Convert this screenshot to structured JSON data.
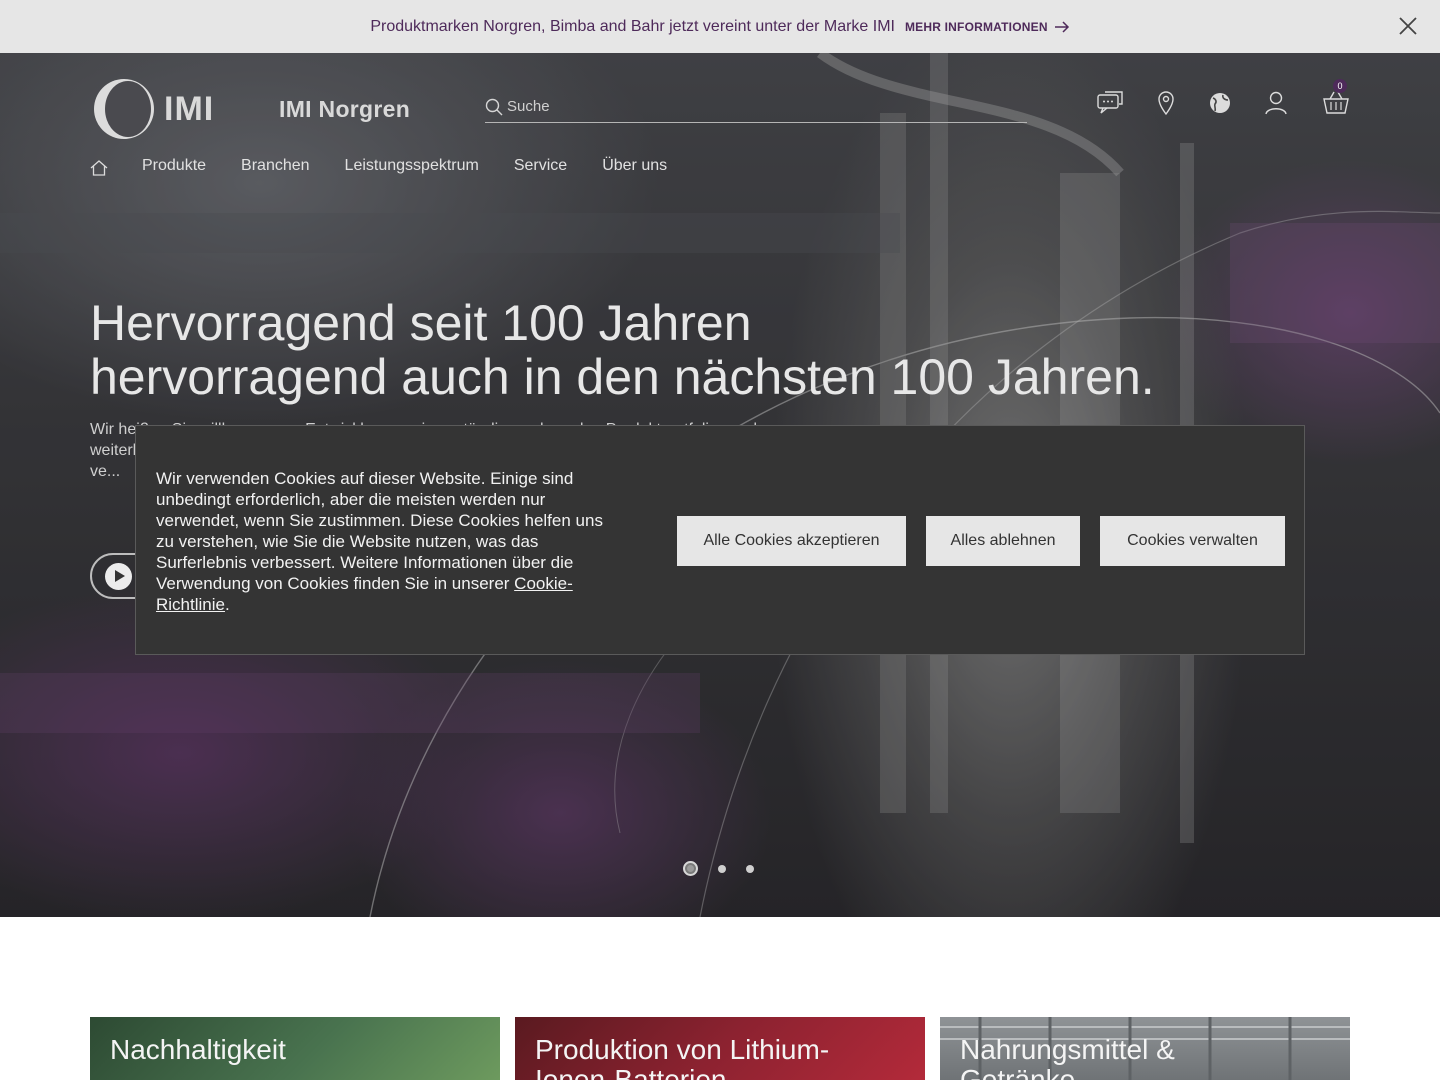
{
  "announcement": {
    "text": "Produktmarken Norgren, Bimba and Bahr jetzt vereint unter der Marke IMI",
    "link_label": "MEHR INFORMATIONEN"
  },
  "header": {
    "logo_text": "IMI",
    "brand_name": "IMI Norgren",
    "search_placeholder": "Suche",
    "cart_count": "0",
    "icons": [
      "chat-icon",
      "location-icon",
      "globe-icon",
      "user-icon",
      "cart-icon"
    ]
  },
  "nav": {
    "items": [
      "Produkte",
      "Branchen",
      "Leistungsspektrum",
      "Service",
      "Über uns"
    ]
  },
  "hero": {
    "title_line1": "Hervorragend seit 100 Jahren",
    "title_line2": "hervorragend auch in den nächsten 100 Jahren.",
    "subtitle": "Wir heißen Sie willkommen ... Entwicklungen eines ständig wachsenden Produktportfolios und weiterhin in guter Zusammenarbeit. Nutzen Sie das Know-how u... technik, um Sie... und Ihr - ve..."
  },
  "carousel": {
    "slides": 3,
    "active_index": 0
  },
  "cookie_banner": {
    "text": "Wir verwenden Cookies auf dieser Website. Einige sind unbedingt erforderlich, aber die meisten werden nur verwendet, wenn Sie zustimmen. Diese Cookies helfen uns zu verstehen, wie Sie die Website nutzen, was das Surferlebnis verbessert. Weitere Informationen über die Verwendung von Cookies finden Sie in unserer ",
    "link_label": "Cookie-Richtlinie",
    "text_end": ".",
    "accept_label": "Alle Cookies akzeptieren",
    "reject_label": "Alles ablehnen",
    "manage_label": "Cookies verwalten"
  },
  "cards": [
    {
      "title": "Nachhaltigkeit"
    },
    {
      "title": "Produktion von Lithium-Ionen-Batterien"
    },
    {
      "title": "Nahrungsmittel & Getränke"
    }
  ],
  "colors": {
    "brand_purple": "#4e2a5a",
    "announcement_bg": "#e6e6e6",
    "cookie_bg": "#343434",
    "cookie_button_bg": "#e6e6e6"
  }
}
